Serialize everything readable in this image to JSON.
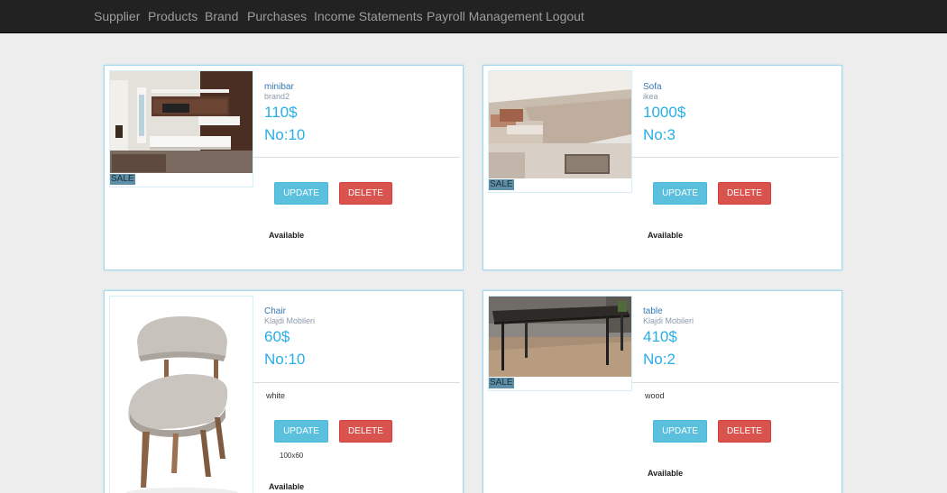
{
  "nav": {
    "items": [
      "Supplier",
      "Products",
      "Brand",
      "Purchases",
      "Income Statements",
      "Payroll Management",
      "Logout"
    ]
  },
  "products": [
    {
      "name": "minibar",
      "brand": "brand2",
      "price": "110$",
      "qty": "No:10",
      "sale": "SALE",
      "status": "Available",
      "image": "tv-wall-unit"
    },
    {
      "name": "Sofa",
      "brand": "ikea",
      "price": "1000$",
      "qty": "No:3",
      "sale": "SALE",
      "status": "Available",
      "image": "corner-sofa"
    },
    {
      "name": "Chair",
      "brand": "Klajdi Mobileri",
      "price": "60$",
      "qty": "No:10",
      "desc": "white",
      "size": "100x60",
      "status": "Available",
      "image": "chair"
    },
    {
      "name": "table",
      "brand": "Klajdi Mobileri",
      "price": "410$",
      "qty": "No:2",
      "sale": "SALE",
      "desc": "wood",
      "status": "Available",
      "image": "dining-table"
    }
  ],
  "buttons": {
    "update": "UPDATE",
    "delete": "DELETE"
  },
  "colors": {
    "navbar": "#222222",
    "price": "#29aee6",
    "update": "#5bc0de",
    "delete": "#d9534f",
    "card_border": "#a8d8ef"
  }
}
